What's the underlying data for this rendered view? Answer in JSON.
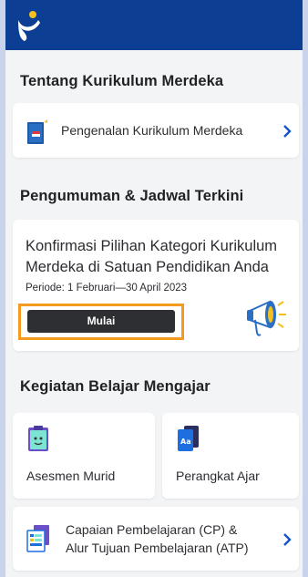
{
  "header": {
    "logo_icon": "app-logo-icon",
    "brand_color": "#0c3f93",
    "accent_color": "#f4c020"
  },
  "sections": {
    "about": {
      "title": "Tentang Kurikulum Merdeka",
      "item": {
        "label": "Pengenalan Kurikulum Merdeka",
        "icon": "book-icon"
      }
    },
    "announcements": {
      "title": "Pengumuman & Jadwal Terkini",
      "card": {
        "title": "Konfirmasi Pilihan Kategori Kurikulum Merdeka di Satuan Pendidikan Anda",
        "period": "Periode: 1 Februari—30 April 2023",
        "button_label": "Mulai",
        "icon": "megaphone-icon",
        "highlight_color": "#f39a1f"
      }
    },
    "teaching": {
      "title": "Kegiatan Belajar Mengajar",
      "tiles": [
        {
          "label": "Asesmen Murid",
          "icon": "assessment-icon"
        },
        {
          "label": "Perangkat Ajar",
          "icon": "teaching-kit-icon"
        }
      ],
      "item": {
        "line1": "Capaian Pembelajaran (CP)  &",
        "line2": "Alur Tujuan Pembelajaran (ATP)",
        "icon": "documents-icon"
      }
    }
  }
}
